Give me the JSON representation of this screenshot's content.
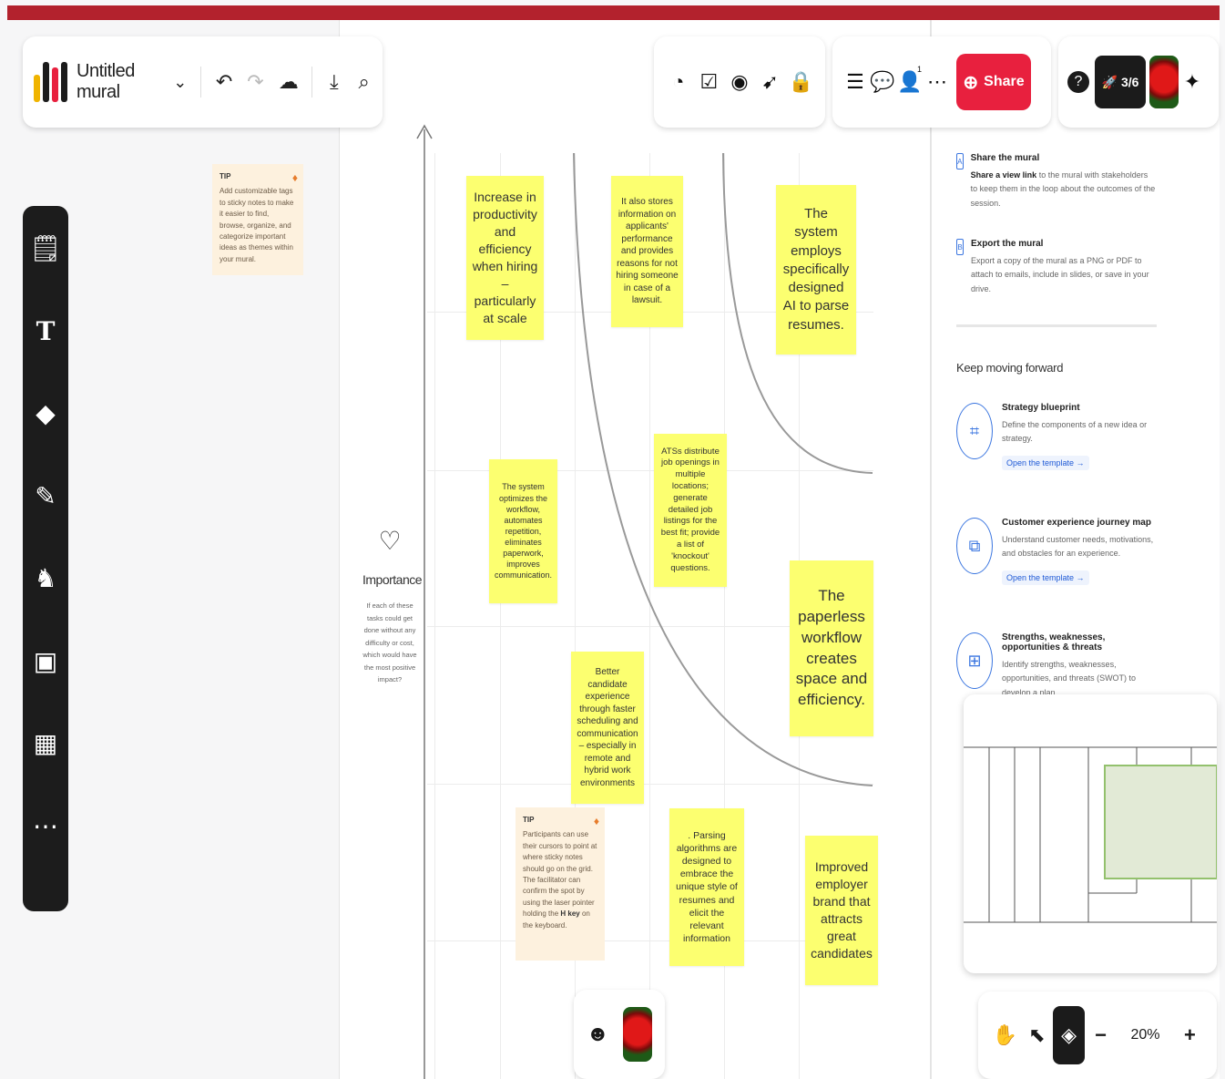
{
  "app": {
    "title": "Untitled mural"
  },
  "toolbar": {
    "share_label": "Share",
    "timer_label": "3/6",
    "collaborator_count": "1"
  },
  "tips": [
    {
      "label": "TIP",
      "text": "Add customizable tags to sticky notes to make it easier to find, browse, organize, and categorize important ideas as themes within your mural."
    },
    {
      "label": "TIP",
      "text_before": "Participants can use their cursors to point at where sticky notes should go on the grid. The facilitator can confirm the spot by using the laser pointer holding the",
      "text_bold": "H key",
      "text_after": "on the keyboard."
    }
  ],
  "axis": {
    "title": "Importance",
    "description": "If each of these tasks could get done without any difficulty or cost, which would have the most positive impact?"
  },
  "stickies": [
    {
      "text": "Increase in productivity and efficiency when hiring – particularly at scale"
    },
    {
      "text": "It also stores information on applicants' performance and provides reasons for not hiring someone in case of a lawsuit."
    },
    {
      "text": "The system employs specifically designed AI to parse resumes."
    },
    {
      "text": "ATSs distribute job openings in multiple locations; generate detailed job listings for the best fit; provide a list of 'knockout' questions."
    },
    {
      "text": "The system optimizes the workflow, automates repetition, eliminates paperwork, improves communication."
    },
    {
      "text": "The paperless workflow creates space and efficiency."
    },
    {
      "text": "Better candidate experience through faster scheduling and communication – especially in remote and hybrid work environments"
    },
    {
      "text": ". Parsing algorithms are designed to embrace the unique style of resumes and elicit the relevant information"
    },
    {
      "text": "Improved employer brand that attracts great candidates"
    }
  ],
  "panel": {
    "share": {
      "title": "Share the mural",
      "bold": "Share a view link",
      "text": "to the mural with stakeholders to keep them in the loop about the outcomes of the session."
    },
    "export": {
      "title": "Export the mural",
      "text": "Export a copy of the mural as a PNG or PDF to attach to emails, include in slides, or save in your drive."
    },
    "keep_moving": "Keep moving forward",
    "templates": [
      {
        "title": "Strategy blueprint",
        "text": "Define the components of a new idea or strategy.",
        "link": "Open the template →"
      },
      {
        "title": "Customer experience journey map",
        "text": "Understand customer needs, motivations, and obstacles for an experience.",
        "link": "Open the template →"
      },
      {
        "title": "Strengths, weaknesses, opportunities & threats",
        "text": "Identify strengths, weaknesses, opportunities, and threats (SWOT) to develop a plan."
      }
    ]
  },
  "zoom": {
    "level": "20%"
  },
  "colors": {
    "accent": "#b3222d",
    "share": "#e8203e",
    "sticky": "#fcff70",
    "tip": "#fdf1de",
    "link": "#1f5ad6"
  }
}
